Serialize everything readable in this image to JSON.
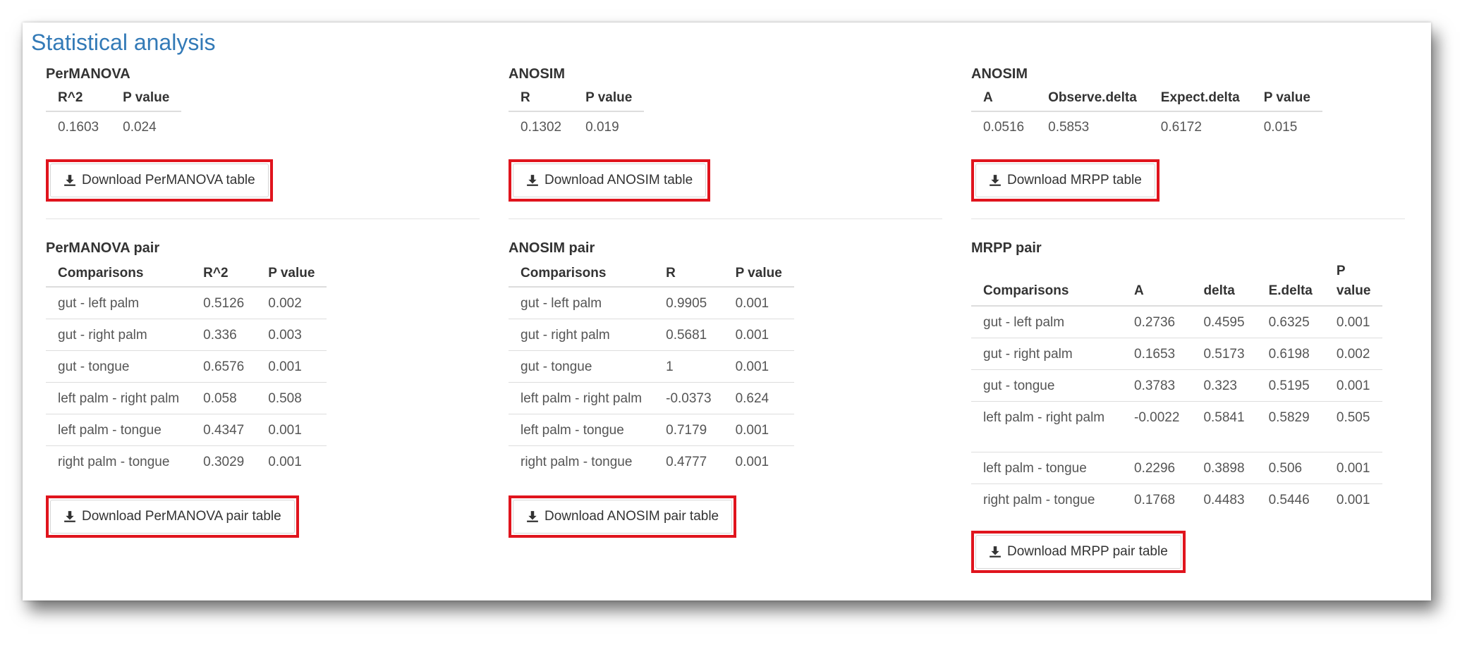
{
  "page": {
    "title": "Statistical analysis"
  },
  "permanova": {
    "title": "PerMANOVA",
    "headers": [
      "R^2",
      "P value"
    ],
    "row": [
      "0.1603",
      "0.024"
    ],
    "download_label": "Download PerMANOVA table"
  },
  "anosim": {
    "title": "ANOSIM",
    "headers": [
      "R",
      "P value"
    ],
    "row": [
      "0.1302",
      "0.019"
    ],
    "download_label": "Download ANOSIM table"
  },
  "mrpp": {
    "title": "ANOSIM",
    "headers": [
      "A",
      "Observe.delta",
      "Expect.delta",
      "P value"
    ],
    "row": [
      "0.0516",
      "0.5853",
      "0.6172",
      "0.015"
    ],
    "download_label": "Download MRPP table"
  },
  "permanova_pair": {
    "title": "PerMANOVA pair",
    "headers": [
      "Comparisons",
      "R^2",
      "P value"
    ],
    "rows": [
      [
        "gut - left palm",
        "0.5126",
        "0.002"
      ],
      [
        "gut - right palm",
        "0.336",
        "0.003"
      ],
      [
        "gut - tongue",
        "0.6576",
        "0.001"
      ],
      [
        "left palm - right palm",
        "0.058",
        "0.508"
      ],
      [
        "left palm - tongue",
        "0.4347",
        "0.001"
      ],
      [
        "right palm - tongue",
        "0.3029",
        "0.001"
      ]
    ],
    "download_label": "Download PerMANOVA pair table"
  },
  "anosim_pair": {
    "title": "ANOSIM pair",
    "headers": [
      "Comparisons",
      "R",
      "P value"
    ],
    "rows": [
      [
        "gut - left palm",
        "0.9905",
        "0.001"
      ],
      [
        "gut - right palm",
        "0.5681",
        "0.001"
      ],
      [
        "gut - tongue",
        "1",
        "0.001"
      ],
      [
        "left palm - right palm",
        "-0.0373",
        "0.624"
      ],
      [
        "left palm - tongue",
        "0.7179",
        "0.001"
      ],
      [
        "right palm - tongue",
        "0.4777",
        "0.001"
      ]
    ],
    "download_label": "Download ANOSIM pair table"
  },
  "mrpp_pair": {
    "title": "MRPP pair",
    "headers": [
      "Comparisons",
      "A",
      "delta",
      "E.delta",
      "P value"
    ],
    "rows": [
      [
        "gut - left palm",
        "0.2736",
        "0.4595",
        "0.6325",
        "0.001"
      ],
      [
        "gut - right palm",
        "0.1653",
        "0.5173",
        "0.6198",
        "0.002"
      ],
      [
        "gut - tongue",
        "0.3783",
        "0.323",
        "0.5195",
        "0.001"
      ],
      [
        "left palm - right palm",
        "-0.0022",
        "0.5841",
        "0.5829",
        "0.505"
      ],
      [
        "left palm - tongue",
        "0.2296",
        "0.3898",
        "0.506",
        "0.001"
      ],
      [
        "right palm - tongue",
        "0.1768",
        "0.4483",
        "0.5446",
        "0.001"
      ]
    ],
    "download_label": "Download MRPP pair table"
  },
  "colors": {
    "title": "#337ab7",
    "highlight": "#e0141d"
  },
  "icons": {
    "download": "download-icon"
  }
}
